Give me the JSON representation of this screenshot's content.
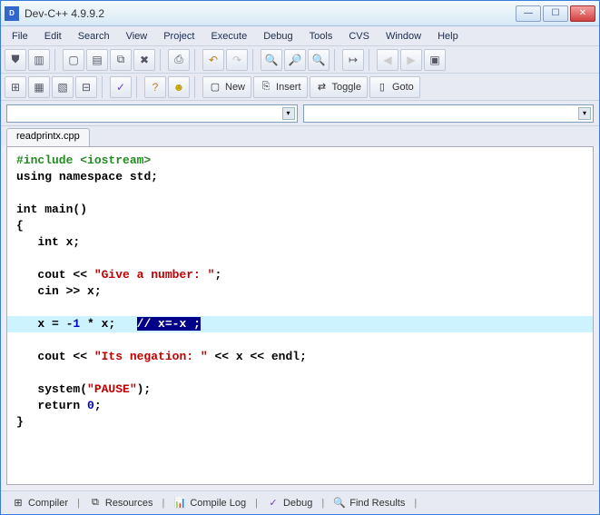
{
  "title": "Dev-C++ 4.9.9.2",
  "menu": [
    "File",
    "Edit",
    "Search",
    "View",
    "Project",
    "Execute",
    "Debug",
    "Tools",
    "CVS",
    "Window",
    "Help"
  ],
  "toolbar2": {
    "new": "New",
    "insert": "Insert",
    "toggle": "Toggle",
    "goto": "Goto"
  },
  "tab": "readprintx.cpp",
  "code": {
    "l1a": "#include ",
    "l1b": "<iostream>",
    "l2a": "using",
    "l2b": " namespace ",
    "l2c": "std",
    "l2d": ";",
    "l4a": "int",
    "l4b": " main()",
    "l5": "{",
    "l6a": "   int",
    "l6b": " x;",
    "l8a": "   cout << ",
    "l8b": "\"Give a number: \"",
    "l8c": ";",
    "l9": "   cin >> x;",
    "l11a": "   x = -",
    "l11b": "1",
    "l11c": " * x;   ",
    "l11sel": "// x=-x ;",
    "l13a": "   cout << ",
    "l13b": "\"Its negation: \"",
    "l13c": " << x << endl;",
    "l15a": "   system(",
    "l15b": "\"PAUSE\"",
    "l15c": ");",
    "l16a": "   return ",
    "l16b": "0",
    "l16c": ";",
    "l17": "}"
  },
  "status": {
    "compiler": "Compiler",
    "resources": "Resources",
    "compilelog": "Compile Log",
    "debug": "Debug",
    "findresults": "Find Results"
  }
}
